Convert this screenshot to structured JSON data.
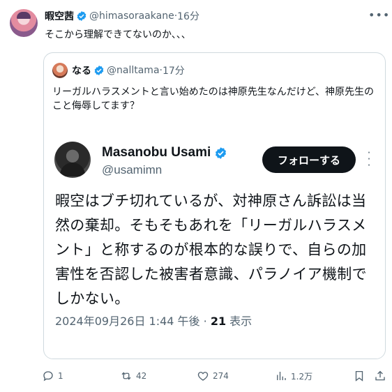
{
  "tweet": {
    "author_name": "暇空茜",
    "handle": "@himasoraakane",
    "time": "16分",
    "text": "そこから理解できてないのか、、、"
  },
  "quote": {
    "author_name": "なる",
    "handle": "@nalltama",
    "time": "17分",
    "text": "リーガルハラスメントと言い始めたのは神原先生なんだけど、神原先生のこと侮辱してます？"
  },
  "screenshot_tweet": {
    "author_name": "Masanobu Usami",
    "handle": "@usamimn",
    "follow_label": "フォローする",
    "body": "暇空はブチ切れているが、対神原さん訴訟は当然の棄却。そもそもあれを「リーガルハラスメント」と称するのが根本的な誤りで、自らの加害性を否認した被害者意識、パラノイア機制でしかない。",
    "timestamp": "2024年09月26日 1:44 午後 · ",
    "views_count": "21",
    "views_label": " 表示"
  },
  "actions": {
    "reply_count": "1",
    "retweet_count": "42",
    "like_count": "274",
    "views_count": "1.2万"
  },
  "separators": {
    "dot": " · "
  },
  "colors": {
    "verified": "#1d9bf0",
    "text": "#0f1419",
    "muted": "#536471",
    "border": "#cfd9de"
  },
  "icons": [
    "verified-badge-icon",
    "more-icon",
    "reply-icon",
    "retweet-icon",
    "like-icon",
    "views-icon",
    "bookmark-icon",
    "share-icon"
  ]
}
